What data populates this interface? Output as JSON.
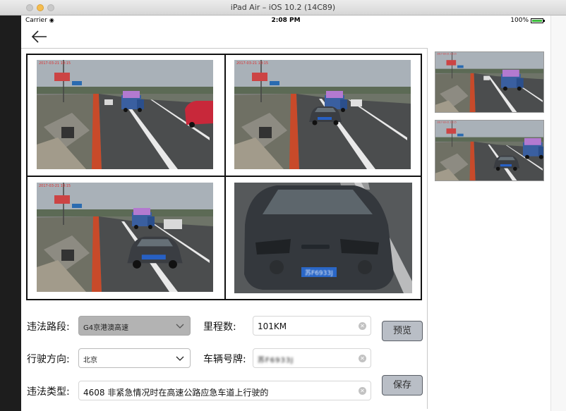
{
  "window": {
    "title": "iPad Air – iOS 10.2 (14C89)"
  },
  "status_bar": {
    "carrier": "Carrier",
    "time": "2:08 PM",
    "battery": "100%"
  },
  "form": {
    "road_label": "违法路段:",
    "road_value": "G4京港澳高速",
    "mileage_label": "里程数:",
    "mileage_value": "101KM",
    "direction_label": "行驶方向:",
    "direction_value": "北京",
    "plate_label": "车辆号牌:",
    "plate_value": "苏F6933J",
    "violation_label": "违法类型:",
    "violation_value": "4608 非紧急情况时在高速公路应急车道上行驶的"
  },
  "buttons": {
    "preview": "预览",
    "save": "保存"
  },
  "colors": {
    "button_bg": "#b9bec6",
    "road_dropdown_bg": "#b3b3b3",
    "clear_icon": "#c2c2c2"
  },
  "icons": {
    "back": "back-arrow-icon",
    "clear": "clear-circle-icon",
    "dropdown": "chevron-down-icon"
  },
  "evidence_photos": [
    {
      "scene": "highway-wide-truck-red-car"
    },
    {
      "scene": "highway-wide-truck-gray-car"
    },
    {
      "scene": "highway-car-in-emergency-lane"
    },
    {
      "scene": "close-up-gray-sedan"
    }
  ],
  "thumbnails": [
    {
      "scene": "highway-truck"
    },
    {
      "scene": "highway-gray-car"
    }
  ]
}
